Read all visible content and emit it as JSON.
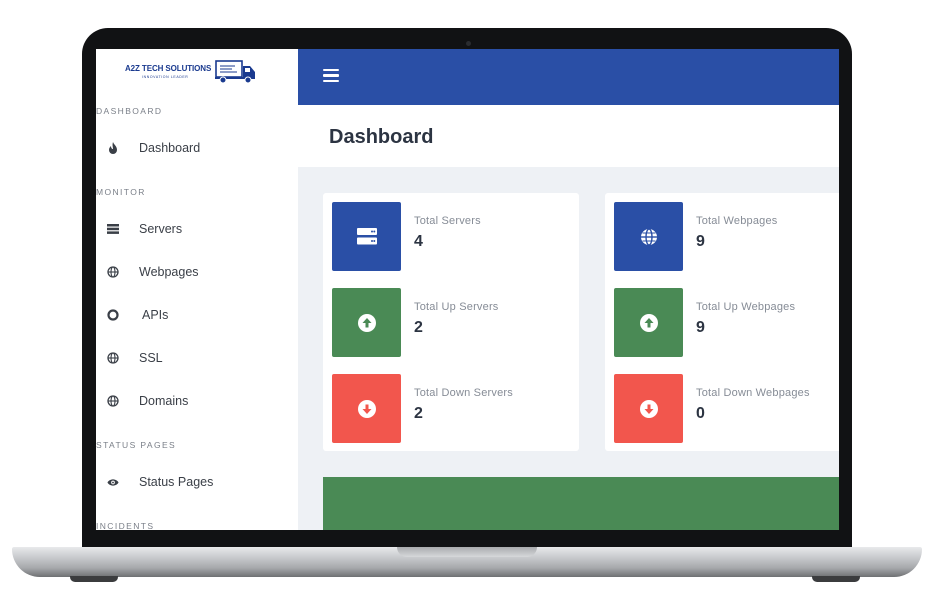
{
  "brand": {
    "name": "A2Z TECH SOLUTIONS",
    "tagline": "INNOVATION LEADER"
  },
  "colors": {
    "topbar": "#2a4fa6",
    "info": "#2a4fa6",
    "success": "#4a8a55",
    "danger": "#f2564d"
  },
  "sidebar": {
    "sections": [
      {
        "label": "DASHBOARD"
      },
      {
        "label": "MONITOR"
      },
      {
        "label": "STATUS PAGES"
      },
      {
        "label": "INCIDENTS"
      }
    ],
    "items": [
      {
        "label": "Dashboard",
        "icon": "fire-icon"
      },
      {
        "label": "Servers",
        "icon": "server-icon"
      },
      {
        "label": "Webpages",
        "icon": "globe-icon"
      },
      {
        "label": "APIs",
        "icon": "circle-icon"
      },
      {
        "label": "SSL",
        "icon": "globe-icon"
      },
      {
        "label": "Domains",
        "icon": "globe-icon"
      },
      {
        "label": "Status Pages",
        "icon": "eye-icon"
      }
    ]
  },
  "header": {
    "title": "Dashboard"
  },
  "servers": [
    {
      "label": "Total Servers",
      "value": "4",
      "icon": "server-icon"
    },
    {
      "label": "Total Up Servers",
      "value": "2",
      "icon": "arrow-up-circle-icon"
    },
    {
      "label": "Total Down Servers",
      "value": "2",
      "icon": "arrow-down-circle-icon"
    }
  ],
  "webpages": [
    {
      "label": "Total Webpages",
      "value": "9",
      "icon": "globe-icon"
    },
    {
      "label": "Total Up Webpages",
      "value": "9",
      "icon": "arrow-up-circle-icon"
    },
    {
      "label": "Total Down Webpages",
      "value": "0",
      "icon": "arrow-down-circle-icon"
    }
  ]
}
